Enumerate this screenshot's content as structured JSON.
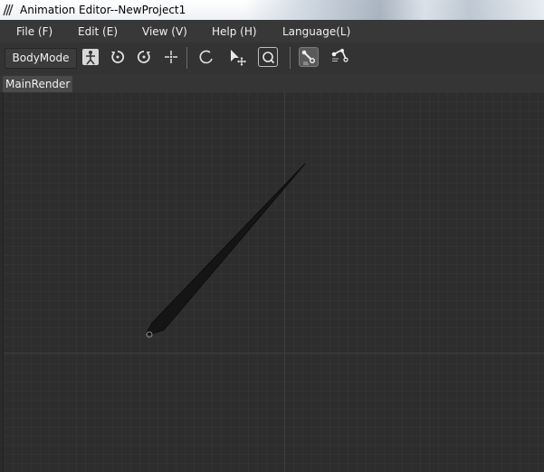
{
  "window": {
    "title": "Animation Editor--NewProject1"
  },
  "menu": {
    "items": [
      {
        "label": "File (F)"
      },
      {
        "label": "Edit (E)"
      },
      {
        "label": "View (V)"
      },
      {
        "label": "Help (H)"
      },
      {
        "label": "Language(L)"
      }
    ]
  },
  "toolbar": {
    "mode_value": "BodyMode",
    "icons": [
      "skeleton-icon",
      "rotate-left-icon",
      "rotate-right-icon",
      "move-cross-icon",
      "rotate-icon",
      "select-move-icon",
      "zoom-icon",
      "bone-edit-icon",
      "bone-link-icon"
    ],
    "active_tool": "bone-edit-icon",
    "focused_tool": "zoom-icon"
  },
  "tabs": [
    {
      "label": "MainRender"
    }
  ],
  "colors": {
    "viewport_bg": "#2d2d2d",
    "bone": "#141414",
    "toolbar_bg": "#333333",
    "menu_bg": "#383838"
  }
}
